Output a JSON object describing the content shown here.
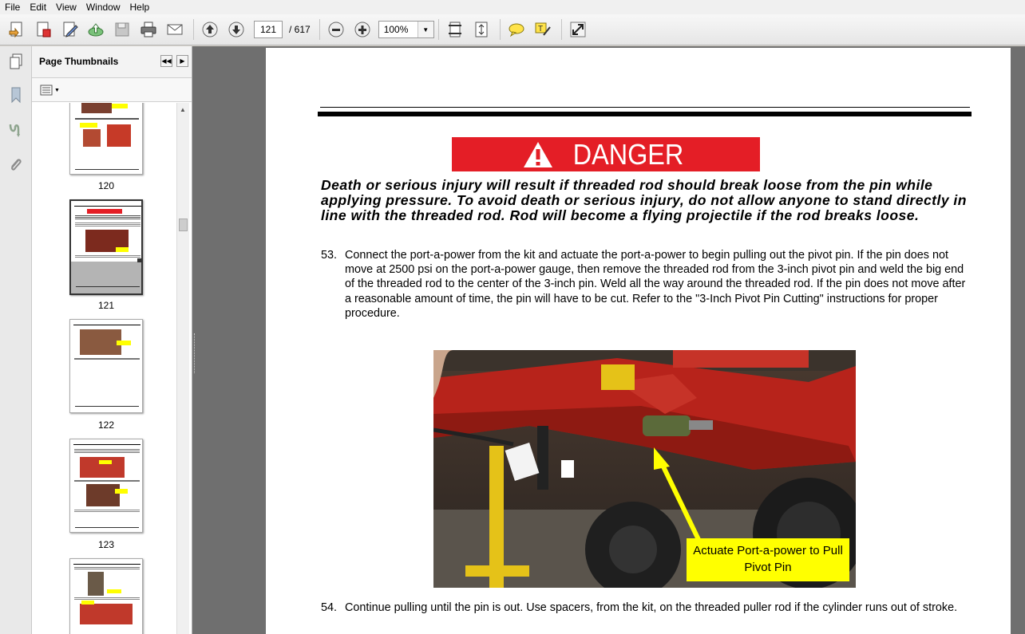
{
  "menu": [
    "File",
    "Edit",
    "View",
    "Window",
    "Help"
  ],
  "toolbar": {
    "current_page": "121",
    "total_pages": "/ 617",
    "zoom": "100%"
  },
  "panel": {
    "title": "Page Thumbnails",
    "thumbnails": [
      {
        "label": "120"
      },
      {
        "label": "121"
      },
      {
        "label": "122"
      },
      {
        "label": "123"
      }
    ]
  },
  "page": {
    "danger_title": "DANGER",
    "danger_message": "Death or serious injury will result if threaded rod should break loose from the pin while applying pressure. To avoid death or serious injury, do not allow anyone to stand directly in line with the threaded rod. Rod will become a flying projectile if the rod breaks loose.",
    "steps": [
      {
        "num": "53.",
        "text": "Connect the port-a-power from the kit and actuate the port-a-power to begin pulling out the pivot pin. If the pin does not move at 2500 psi on the port-a-power gauge, then remove the threaded rod from the 3-inch pivot pin and weld the big end of the threaded rod to the center of the 3-inch pin. Weld all the way around the threaded rod. If the pin does not move after a reasonable amount of time, the pin will have to be cut. Refer to the \"3-Inch Pivot Pin Cutting\" instructions for proper procedure."
      },
      {
        "num": "54.",
        "text": "Continue pulling until the pin is out. Use spacers, from the kit, on the threaded puller rod if the cylinder runs out of stroke."
      }
    ],
    "photo_callout": "Actuate Port-a-power to Pull Pivot Pin"
  },
  "colors": {
    "danger_red": "#e41e26",
    "callout_yellow": "#ffff00",
    "workspace_gray": "#6f6f6f"
  }
}
